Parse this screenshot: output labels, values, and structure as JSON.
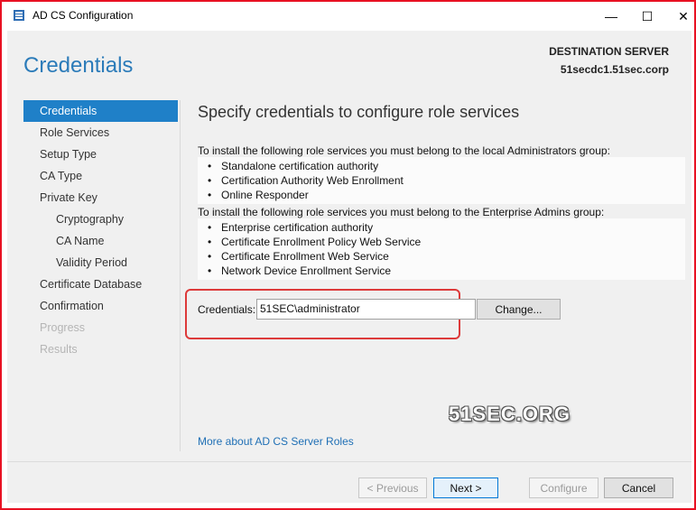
{
  "window": {
    "title": "AD CS Configuration",
    "minimize": "—",
    "maximize": "☐",
    "close": "✕"
  },
  "header": {
    "page_title": "Credentials",
    "destination_label": "DESTINATION SERVER",
    "destination_value": "51secdc1.51sec.corp"
  },
  "nav": {
    "items": [
      {
        "label": "Credentials"
      },
      {
        "label": "Role Services"
      },
      {
        "label": "Setup Type"
      },
      {
        "label": "CA Type"
      },
      {
        "label": "Private Key"
      },
      {
        "label": "Cryptography"
      },
      {
        "label": "CA Name"
      },
      {
        "label": "Validity Period"
      },
      {
        "label": "Certificate Database"
      },
      {
        "label": "Confirmation"
      },
      {
        "label": "Progress"
      },
      {
        "label": "Results"
      }
    ]
  },
  "main": {
    "heading": "Specify credentials to configure role services",
    "local_admin_text": "To install the following role services you must belong to the local Administrators group:",
    "local_admin_items": [
      "Standalone certification authority",
      "Certification Authority Web Enrollment",
      "Online Responder"
    ],
    "enterprise_admin_text": "To install the following role services you must belong to the Enterprise Admins group:",
    "enterprise_admin_items": [
      "Enterprise certification authority",
      "Certificate Enrollment Policy Web Service",
      "Certificate Enrollment Web Service",
      "Network Device Enrollment Service"
    ],
    "credentials_label": "Credentials:",
    "credentials_value": "51SEC\\administrator",
    "change_button": "Change...",
    "more_link": "More about AD CS Server Roles"
  },
  "watermark": "51SEC.ORG",
  "footer": {
    "previous": "< Previous",
    "next": "Next >",
    "configure": "Configure",
    "cancel": "Cancel"
  },
  "colors": {
    "accent": "#1f80c8",
    "title": "#2b7bb9",
    "highlight": "#dd3a3a",
    "window_border": "#e81123"
  }
}
